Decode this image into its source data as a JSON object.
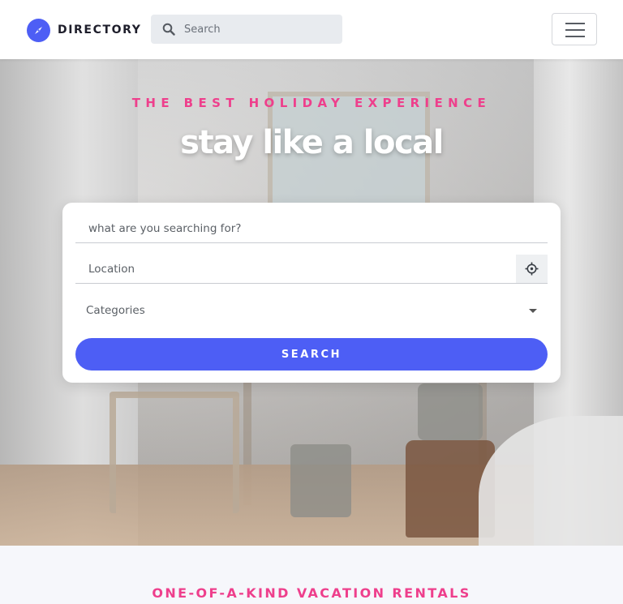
{
  "navbar": {
    "brand_name": "DIRECTORY",
    "logo_icon": "compass-icon",
    "search_placeholder": "Search",
    "menu_icon": "hamburger-menu-icon"
  },
  "hero": {
    "kicker": "THE BEST HOLIDAY EXPERIENCE",
    "title": "stay like a local"
  },
  "search_form": {
    "what_placeholder": "what are you searching for?",
    "location_placeholder": "Location",
    "locate_icon": "crosshair-icon",
    "category_selected": "Categories",
    "submit_label": "SEARCH"
  },
  "section": {
    "title": "ONE-OF-A-KIND VACATION RENTALS"
  },
  "colors": {
    "accent": "#4d5ef5",
    "pink": "#ee3f8c"
  }
}
